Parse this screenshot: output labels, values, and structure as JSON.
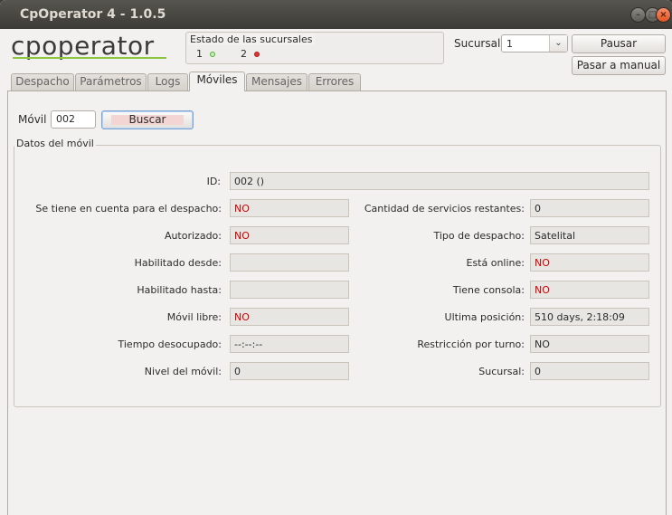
{
  "window": {
    "title": "CpOperator 4 - 1.0.5"
  },
  "logo": {
    "text": "cpoperator"
  },
  "sucursales_status": {
    "title": "Estado de las sucursales",
    "items": [
      {
        "label": "1",
        "status": "green"
      },
      {
        "label": "2",
        "status": "red"
      }
    ]
  },
  "header": {
    "sucursal_label": "Sucursal",
    "sucursal_value": "1",
    "pausar_label": "Pausar",
    "pasar_manual_label": "Pasar a manual"
  },
  "tabs": [
    {
      "label": "Despacho",
      "active": false
    },
    {
      "label": "Parámetros",
      "active": false
    },
    {
      "label": "Logs",
      "active": false
    },
    {
      "label": "Móviles",
      "active": true
    },
    {
      "label": "Mensajes",
      "active": false
    },
    {
      "label": "Errores",
      "active": false
    }
  ],
  "search": {
    "movil_label": "Móvil",
    "movil_value": "002",
    "buscar_label": "Buscar"
  },
  "details": {
    "title": "Datos del móvil",
    "id_label": "ID:",
    "id_value": "002 ()",
    "left": [
      {
        "label": "Se tiene en cuenta para el despacho:",
        "value": "NO",
        "red": true
      },
      {
        "label": "Autorizado:",
        "value": "NO",
        "red": true
      },
      {
        "label": "Habilitado desde:",
        "value": "",
        "red": false
      },
      {
        "label": "Habilitado hasta:",
        "value": "",
        "red": false
      },
      {
        "label": "Móvil libre:",
        "value": "NO",
        "red": true
      },
      {
        "label": "Tiempo desocupado:",
        "value": "--:--:--",
        "red": false
      },
      {
        "label": "Nivel del móvil:",
        "value": "0",
        "red": false
      }
    ],
    "right": [
      {
        "label": "Cantidad de servicios restantes:",
        "value": "0",
        "red": false
      },
      {
        "label": "Tipo de despacho:",
        "value": "Satelital",
        "red": false
      },
      {
        "label": "Está online:",
        "value": "NO",
        "red": true
      },
      {
        "label": "Tiene consola:",
        "value": "NO",
        "red": true
      },
      {
        "label": "Ultima posición:",
        "value": "510 days, 2:18:09",
        "red": false
      },
      {
        "label": "Restricción por turno:",
        "value": "NO",
        "red": false
      },
      {
        "label": "Sucursal:",
        "value": "0",
        "red": false
      }
    ]
  }
}
